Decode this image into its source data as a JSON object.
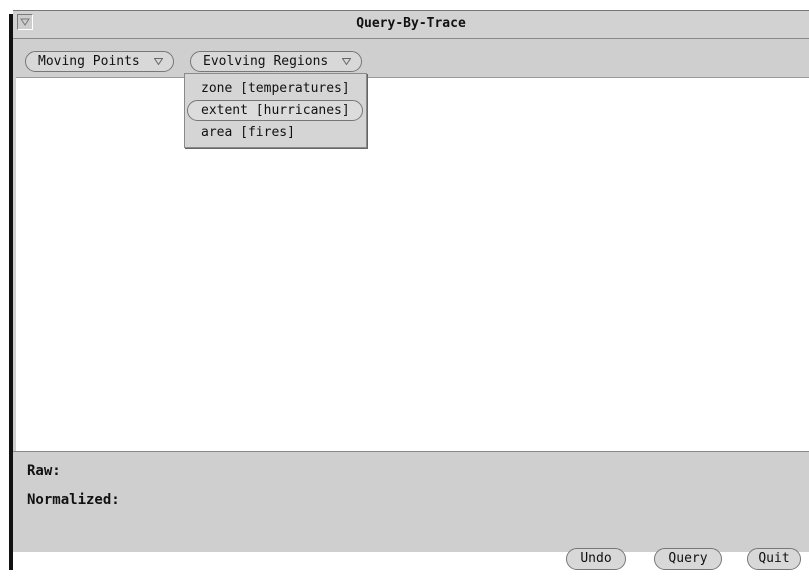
{
  "window": {
    "title": "Query-By-Trace"
  },
  "toolbar": {
    "moving_points_label": "Moving Points",
    "evolving_regions_label": "Evolving Regions"
  },
  "dropdown": {
    "items": [
      {
        "label": "zone [temperatures]"
      },
      {
        "label": "extent [hurricanes]",
        "selected": true
      },
      {
        "label": "area [fires]"
      }
    ]
  },
  "bottom_panel": {
    "raw_label": "Raw:",
    "normalized_label": "Normalized:",
    "buttons": {
      "undo": "Undo",
      "query": "Query",
      "quit": "Quit"
    }
  },
  "icons": {
    "window_menu": "triangle-down-icon",
    "menu_chevron": "triangle-down-icon"
  }
}
